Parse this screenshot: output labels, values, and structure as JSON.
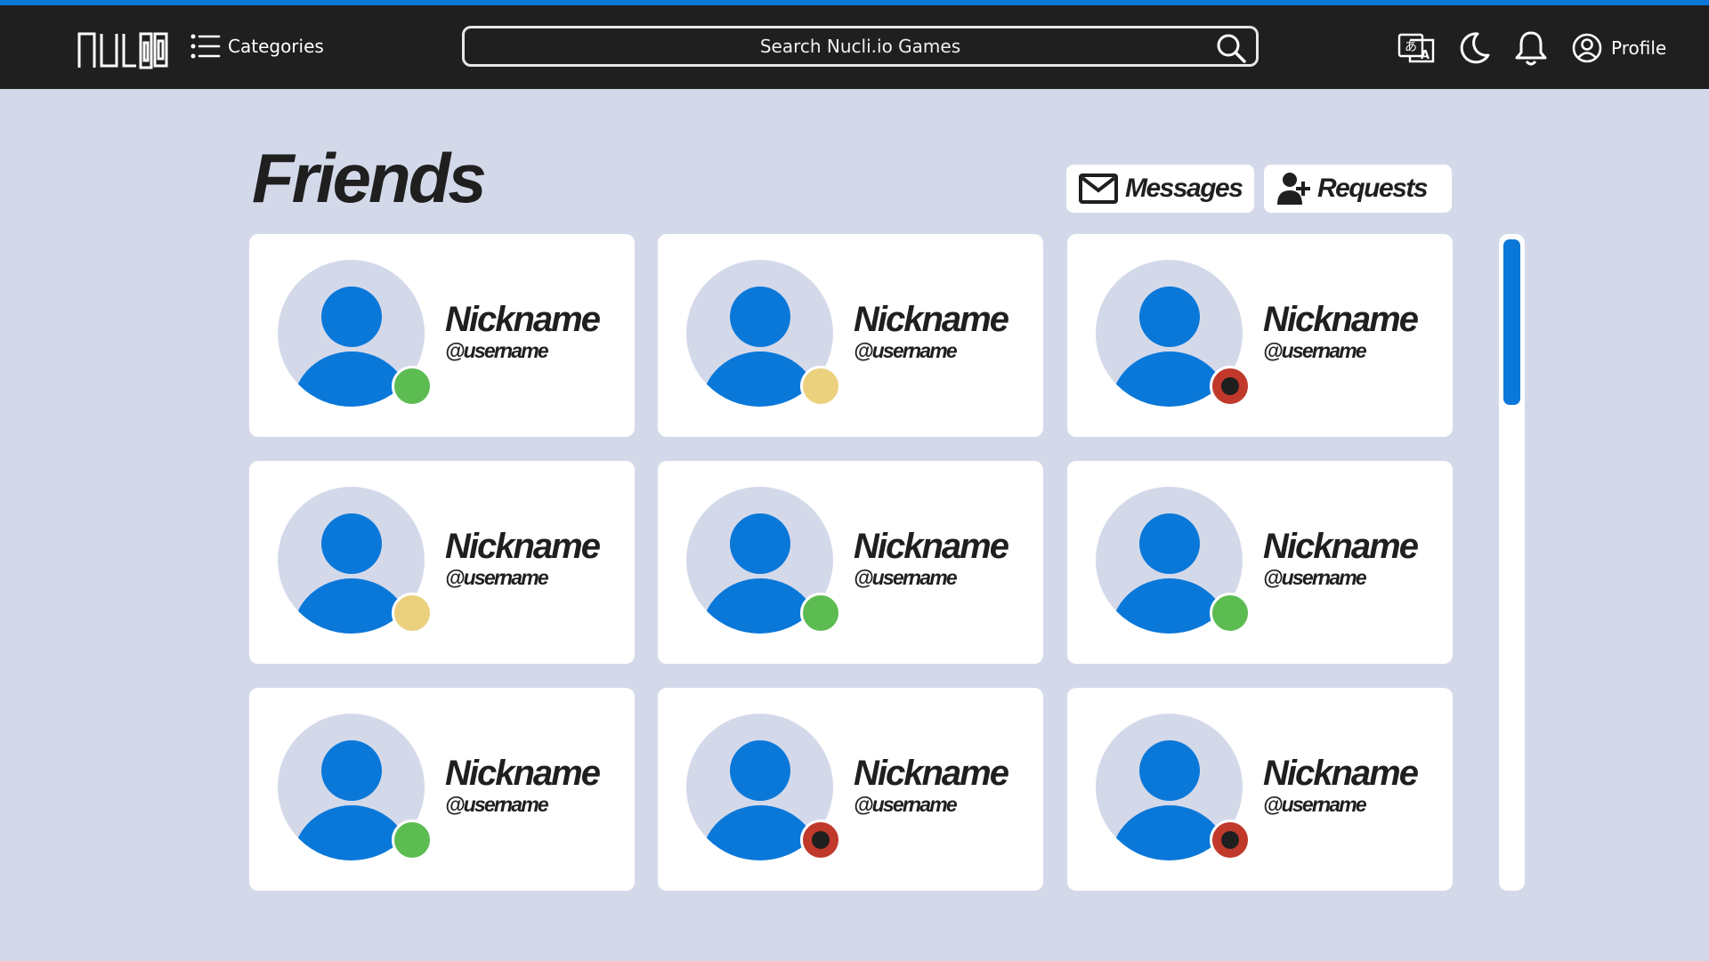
{
  "colors": {
    "accent": "#0a78d9",
    "topbar": "#1f1f1f",
    "page_background": "#d4d9ea",
    "avatar_background": "#d4d9ea",
    "avatar_figure": "#0a78d9",
    "status_online": "#5cbc52",
    "status_away": "#ebd07d",
    "status_busy": "#c0392b"
  },
  "header": {
    "logo_text": "NUCLIO",
    "logo_icon": "nuclio-logo",
    "categories_label": "Categories",
    "categories_icon": "list-icon",
    "search_placeholder": "Search Nucli.io Games",
    "search_icon": "search-icon",
    "language_icon": "translate-icon",
    "theme_icon": "moon-icon",
    "notifications_icon": "bell-icon",
    "profile_label": "Profile",
    "profile_icon": "user-circle-icon"
  },
  "page": {
    "title": "Friends",
    "messages_label": "Messages",
    "messages_icon": "envelope-icon",
    "requests_label": "Requests",
    "requests_icon": "user-plus-icon"
  },
  "friends": [
    {
      "nickname": "Nickname",
      "username": "@username",
      "status": "online"
    },
    {
      "nickname": "Nickname",
      "username": "@username",
      "status": "away"
    },
    {
      "nickname": "Nickname",
      "username": "@username",
      "status": "busy"
    },
    {
      "nickname": "Nickname",
      "username": "@username",
      "status": "away"
    },
    {
      "nickname": "Nickname",
      "username": "@username",
      "status": "online"
    },
    {
      "nickname": "Nickname",
      "username": "@username",
      "status": "online"
    },
    {
      "nickname": "Nickname",
      "username": "@username",
      "status": "online"
    },
    {
      "nickname": "Nickname",
      "username": "@username",
      "status": "busy"
    },
    {
      "nickname": "Nickname",
      "username": "@username",
      "status": "busy"
    }
  ]
}
